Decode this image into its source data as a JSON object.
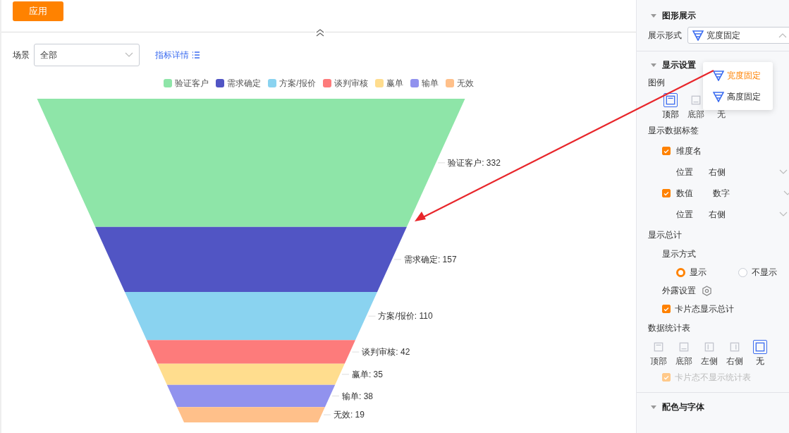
{
  "apply_button": "应用",
  "filter": {
    "label": "场景",
    "value": "全部"
  },
  "details_link": "指标详情",
  "funnel": {
    "segments": [
      {
        "name": "验证客户",
        "label": "验证客户: 332",
        "color": "#8ee5a8"
      },
      {
        "name": "需求确定",
        "label": "需求确定: 157",
        "color": "#5155c4"
      },
      {
        "name": "方案/报价",
        "label": "方案/报价: 110",
        "color": "#8ad3f0"
      },
      {
        "name": "谈判审核",
        "label": "谈判审核: 42",
        "color": "#fd7b7b"
      },
      {
        "name": "赢单",
        "label": "赢单: 35",
        "color": "#ffdd8e"
      },
      {
        "name": "输单",
        "label": "输单: 38",
        "color": "#9192ee"
      },
      {
        "name": "无效",
        "label": "无效: 19",
        "color": "#ffc08a"
      }
    ]
  },
  "panel": {
    "chart_section": {
      "title": "图形展示",
      "style_label": "展示形式",
      "style_value": "宽度固定",
      "dropdown_open": true,
      "options": [
        {
          "label": "宽度固定",
          "selected": true
        },
        {
          "label": "高度固定",
          "selected": false
        }
      ]
    },
    "display_section": {
      "title": "显示设置",
      "legend": {
        "title": "图例",
        "positions": [
          {
            "label": "顶部",
            "kind": "top",
            "selected": true
          },
          {
            "label": "底部",
            "kind": "bottom",
            "selected": false
          },
          {
            "label": "无",
            "kind": "blank",
            "selected": false
          }
        ]
      },
      "data_labels": {
        "title": "显示数据标签",
        "items": [
          {
            "label": "维度名",
            "checked": true,
            "position_label": "位置",
            "position_value": "右侧"
          },
          {
            "label": "数值",
            "checked": true,
            "format": "数字",
            "position_label": "位置",
            "position_value": "右侧"
          }
        ]
      },
      "total": {
        "title": "显示总计",
        "mode_label": "显示方式",
        "modes": [
          {
            "label": "显示",
            "selected": true
          },
          {
            "label": "不显示",
            "selected": false
          }
        ],
        "exposure_label": "外露设置",
        "card_total": {
          "label": "卡片态显示总计",
          "checked": true
        }
      },
      "stats_table": {
        "title": "数据统计表",
        "positions": [
          {
            "label": "顶部",
            "kind": "top",
            "selected": false
          },
          {
            "label": "底部",
            "kind": "bottom",
            "selected": false
          },
          {
            "label": "左侧",
            "kind": "left",
            "selected": false
          },
          {
            "label": "右侧",
            "kind": "right",
            "selected": false
          },
          {
            "label": "无",
            "kind": "none",
            "selected": true
          }
        ],
        "card_hide": {
          "label": "卡片态不显示统计表",
          "checked": true,
          "disabled": true
        }
      }
    },
    "color_section": {
      "title": "配色与字体"
    }
  }
}
